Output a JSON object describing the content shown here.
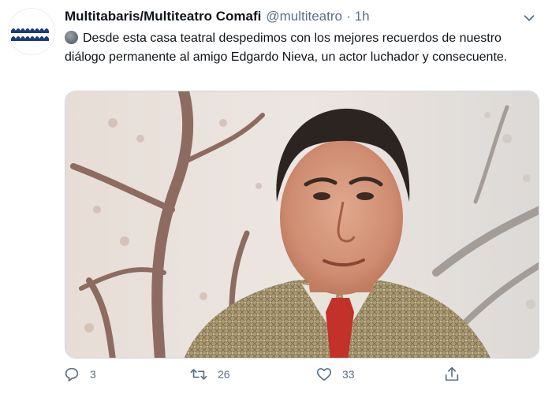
{
  "tweet": {
    "display_name": "Multitabaris/Multiteatro Comafi",
    "handle": "@multiteatro",
    "separator": "·",
    "time": "1h",
    "text": "Desde esta casa teatral despedimos con los mejores recuerdos de nuestro diálogo permanente al amigo Edgardo Nieva, un actor luchador y consecuente.",
    "leading_emoji": "dark-gray-circle"
  },
  "avatar": {
    "logo": "multiteatro-waves-logo",
    "color": "#1a3b7a"
  },
  "media": {
    "description_icon": "portrait-photo"
  },
  "actions": {
    "reply_count": "3",
    "retweet_count": "26",
    "like_count": "33"
  },
  "colors": {
    "text": "#0f1419",
    "secondary": "#5b7083",
    "border": "#cfd9de"
  }
}
